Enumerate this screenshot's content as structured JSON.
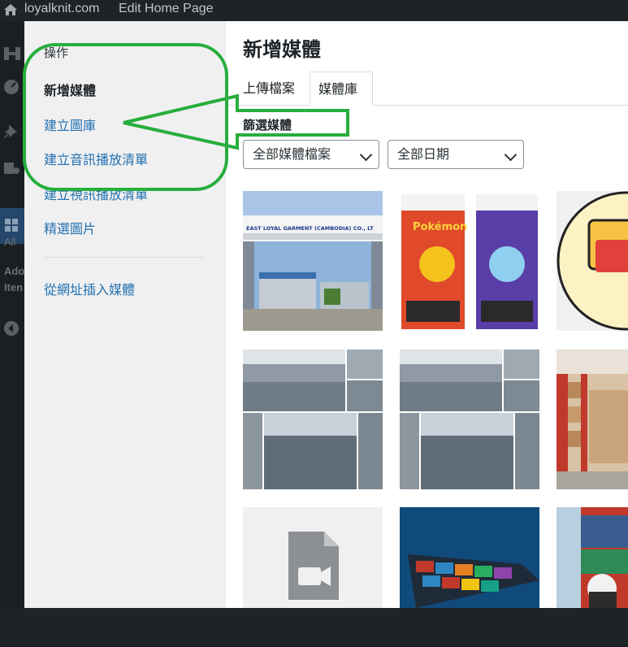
{
  "adminbar": {
    "site": "loyalknit.com",
    "edit": "Edit Home Page"
  },
  "adminmenu": {
    "all_label": "All",
    "add_label": "Ado",
    "items_label": "Iten"
  },
  "sidebar": {
    "heading": "操作",
    "items": [
      {
        "label": "新增媒體",
        "active": true
      },
      {
        "label": "建立圖庫"
      },
      {
        "label": "建立音訊播放清單"
      },
      {
        "label": "建立視訊播放清單"
      },
      {
        "label": "精選圖片"
      }
    ],
    "url_insert": "從網址插入媒體"
  },
  "frame": {
    "title": "新增媒體",
    "tabs": [
      {
        "label": "上傳檔案"
      },
      {
        "label": "媒體庫",
        "active": true
      }
    ],
    "filter_label": "篩選媒體",
    "type_filter": "全部媒體檔案",
    "date_filter": "全部日期"
  },
  "media": {
    "tiles": [
      {
        "kind": "photo",
        "subject": "factory-gate",
        "sign": "EAST LOYAL GARMENT (CAMBODIA) CO., LT"
      },
      {
        "kind": "photo",
        "subject": "pokemon-packs",
        "card_text": "Pokémon"
      },
      {
        "kind": "icon",
        "subject": "chat-bubble"
      },
      {
        "kind": "photo",
        "subject": "factory-floor-collage"
      },
      {
        "kind": "photo",
        "subject": "factory-floor-collage"
      },
      {
        "kind": "photo",
        "subject": "warehouse-shelves"
      },
      {
        "kind": "file",
        "subject": "video-file-icon"
      },
      {
        "kind": "photo",
        "subject": "container-ship"
      },
      {
        "kind": "photo",
        "subject": "container-yard-worker"
      }
    ]
  },
  "colors": {
    "link": "#2271b1",
    "annotation": "#27ae3c",
    "adminbar": "#1d2327"
  }
}
